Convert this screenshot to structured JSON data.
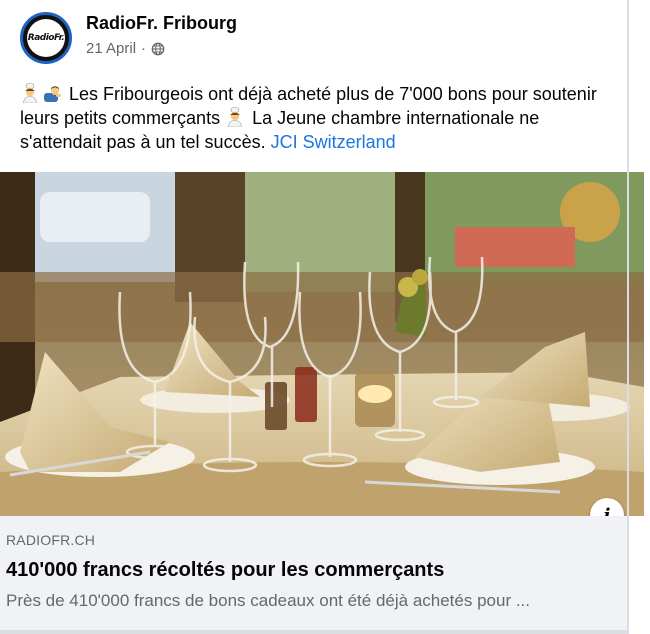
{
  "post": {
    "page_name": "RadioFr. Fribourg",
    "avatar_text": "RadioFr.",
    "date": "21 April",
    "separator": "·",
    "privacy_icon": "globe-icon",
    "text": {
      "emoji_1": "woman-cook-emoji",
      "emoji_2": "person-bowing-emoji",
      "part_1": "Les Fribourgeois ont déjà acheté plus de 7'000 bons pour soutenir leurs petits commerçants",
      "emoji_3": "woman-cook-emoji",
      "part_2": "La Jeune chambre internationale ne s'attendait pas à un tel succès.",
      "link": "JCI Switzerland"
    }
  },
  "link_preview": {
    "image_description_icon": "info-icon",
    "info_symbol": "i",
    "domain": "RADIOFR.CH",
    "headline": "410'000 francs récoltés pour les commerçants",
    "description": "Près de 410'000 francs de bons cadeaux ont été déjà achetés pour ..."
  },
  "colors": {
    "link": "#1b74e4",
    "secondary_text": "#65676b",
    "preview_bg": "#f0f2f5",
    "avatar_ring": "#1d62c4"
  }
}
